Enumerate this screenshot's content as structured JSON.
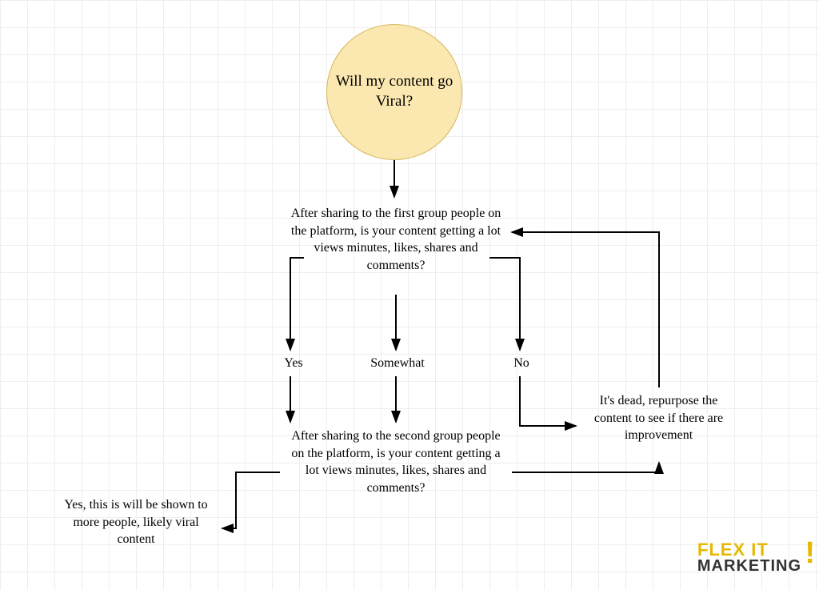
{
  "start": {
    "title": "Will my content go Viral?"
  },
  "q1": {
    "text": "After sharing to the first group people on the platform, is your content getting a lot views minutes, likes, shares and comments?"
  },
  "answers": {
    "yes": "Yes",
    "somewhat": "Somewhat",
    "no": "No"
  },
  "q2": {
    "text": "After sharing to the second group people on the platform, is your content getting a lot views minutes, likes, shares and comments?"
  },
  "viral": {
    "text": "Yes, this is will be shown to more people, likely viral content"
  },
  "dead": {
    "text": "It's dead, repurpose the content to see if there are improvement"
  },
  "logo": {
    "line1": "FLEX IT",
    "line2": "MARKETING"
  }
}
